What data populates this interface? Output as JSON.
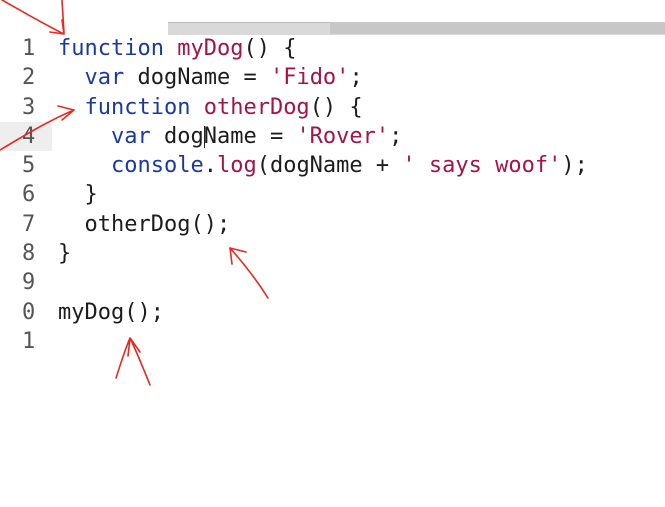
{
  "editor": {
    "line_numbers": [
      "1",
      "2",
      "3",
      "4",
      "5",
      "6",
      "7",
      "8",
      "9",
      "0",
      "1"
    ],
    "lines": [
      {
        "indent": "",
        "tokens": [
          {
            "t": "function",
            "c": "kw"
          },
          {
            "t": " "
          },
          {
            "t": "myDog",
            "c": "fn"
          },
          {
            "t": "() {"
          }
        ]
      },
      {
        "indent": "  ",
        "tokens": [
          {
            "t": "var",
            "c": "kw"
          },
          {
            "t": " dogName = "
          },
          {
            "t": "'Fido'",
            "c": "str"
          },
          {
            "t": ";"
          }
        ]
      },
      {
        "indent": "  ",
        "tokens": [
          {
            "t": "function",
            "c": "kw"
          },
          {
            "t": " "
          },
          {
            "t": "otherDog",
            "c": "fn"
          },
          {
            "t": "() {"
          }
        ]
      },
      {
        "indent": "    ",
        "tokens": [
          {
            "t": "var",
            "c": "kw"
          },
          {
            "t": " dog"
          },
          {
            "t": "|",
            "c": "cursor"
          },
          {
            "t": "Name = "
          },
          {
            "t": "'Rover'",
            "c": "str"
          },
          {
            "t": ";"
          }
        ]
      },
      {
        "indent": "    ",
        "tokens": [
          {
            "t": "console",
            "c": "kw"
          },
          {
            "t": "."
          },
          {
            "t": "log",
            "c": "fn"
          },
          {
            "t": "(dogName + "
          },
          {
            "t": "' says woof'",
            "c": "str"
          },
          {
            "t": ");"
          }
        ]
      },
      {
        "indent": "  ",
        "tokens": [
          {
            "t": "}"
          }
        ]
      },
      {
        "indent": "  ",
        "tokens": [
          {
            "t": "otherDog();"
          }
        ]
      },
      {
        "indent": "",
        "tokens": [
          {
            "t": "}"
          }
        ]
      },
      {
        "indent": "",
        "tokens": []
      },
      {
        "indent": "",
        "tokens": [
          {
            "t": "myDog();"
          }
        ]
      },
      {
        "indent": "",
        "tokens": []
      }
    ],
    "highlighted_line": 4
  },
  "annotation_color": "#e8291f"
}
